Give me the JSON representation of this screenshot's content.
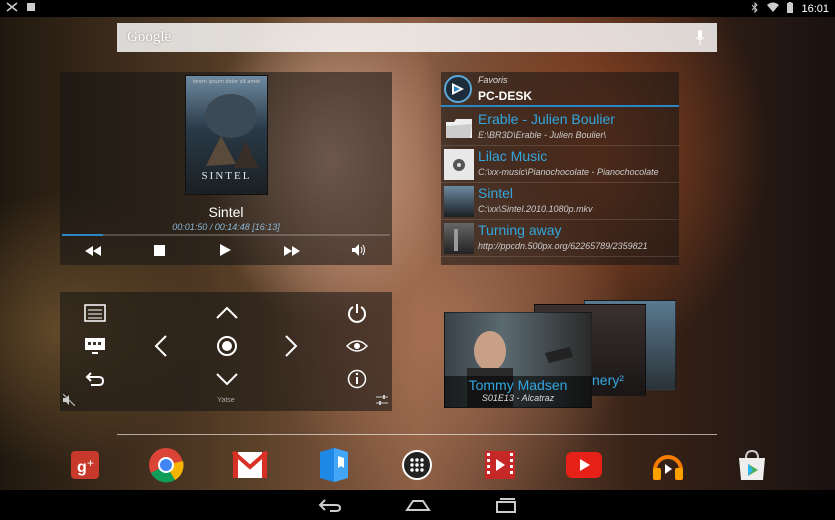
{
  "status_bar": {
    "time": "16:01"
  },
  "search": {
    "label": "Google"
  },
  "media": {
    "poster_title": "SINTEL",
    "poster_top": "lorem ipsum dolor sit amet",
    "title": "Sintel",
    "time": "00:01:50 / 00:14:48 [16:13]",
    "progress": 0.124
  },
  "remote": {
    "label": "Yatse"
  },
  "favorites": {
    "subtitle": "Favoris",
    "host": "PC-DESK",
    "items": [
      {
        "name": "Erable - Julien Boulier",
        "path": "E:\\BR3D\\Erable - Julien Boulier\\",
        "icon": "folder-icon"
      },
      {
        "name": "Lilac Music",
        "path": "C:\\xx-music\\Pianochocolate - Pianochocolate",
        "icon": "music-thumb"
      },
      {
        "name": "Sintel",
        "path": "C:\\xx\\Sintel.2010.1080p.mkv",
        "icon": "movie-thumb"
      },
      {
        "name": "Turning away",
        "path": "http://ppcdn.500px.org/62265789/2359821",
        "icon": "photo-thumb"
      }
    ]
  },
  "tv": {
    "name": "Tommy Madsen",
    "episode": "S01E13 - Alcatraz",
    "overflow_text": "nery²"
  },
  "dock": {
    "apps": [
      "google-plus-icon",
      "chrome-icon",
      "gmail-icon",
      "play-books-icon",
      "app-drawer-icon",
      "play-movies-icon",
      "youtube-icon",
      "play-music-icon",
      "play-store-icon"
    ]
  },
  "colors": {
    "accent": "#33a7e0",
    "progress": "#2b86c5"
  }
}
